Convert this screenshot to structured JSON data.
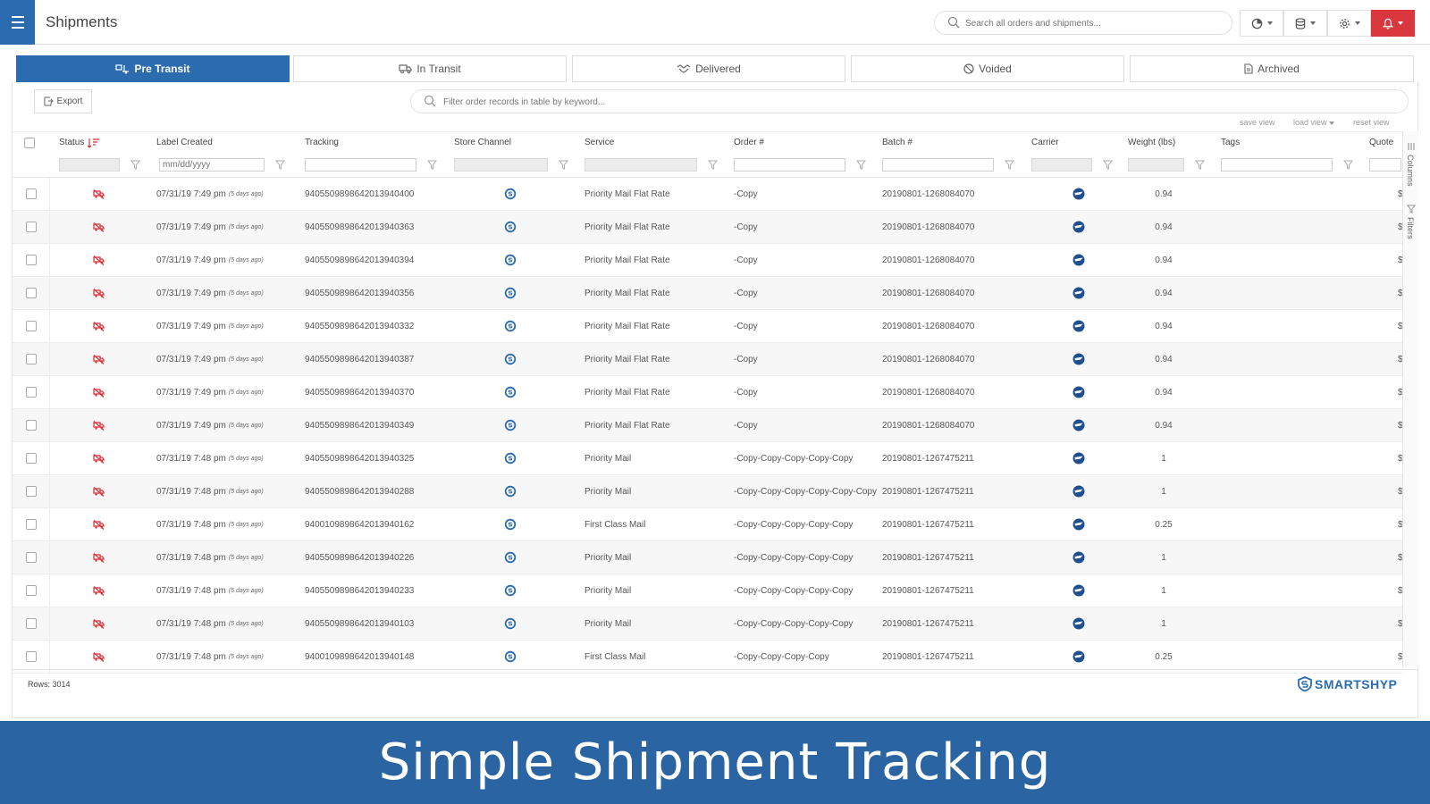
{
  "app": {
    "title": "Shipments"
  },
  "search": {
    "placeholder": "Search all orders and shipments..."
  },
  "toolbar": {
    "buttons": [
      "reports-menu-button",
      "database-menu-button",
      "settings-menu-button",
      "notifications-button"
    ]
  },
  "tabs": [
    {
      "label": "Pre Transit",
      "icon": "truck-loading-icon",
      "active": true
    },
    {
      "label": "In Transit",
      "icon": "truck-icon",
      "active": false
    },
    {
      "label": "Delivered",
      "icon": "handshake-icon",
      "active": false
    },
    {
      "label": "Voided",
      "icon": "ban-icon",
      "active": false
    },
    {
      "label": "Archived",
      "icon": "file-icon",
      "active": false
    }
  ],
  "panel": {
    "export_label": "Export",
    "filter_placeholder": "Filter order records in table by keyword...",
    "save_view": "save view",
    "load_view": "load view",
    "reset_view": "reset view",
    "columns_label": "Columns",
    "filters_label": "Filters",
    "rows_label": "Rows: 3014",
    "brand": "SMARTSHYP"
  },
  "columns": {
    "status": "Status",
    "label_created": "Label Created",
    "tracking": "Tracking",
    "store_channel": "Store Channel",
    "service": "Service",
    "order": "Order #",
    "batch": "Batch #",
    "carrier": "Carrier",
    "weight": "Weight (lbs)",
    "tags": "Tags",
    "quote": "Quote"
  },
  "filters": {
    "date_placeholder": "mm/dd/yyyy"
  },
  "rows": [
    {
      "created": "07/31/19 7:49 pm",
      "ago": "(5 days ago)",
      "tracking": "9405509898642013940400",
      "service": "Priority Mail Flat Rate",
      "order": "-Copy",
      "batch": "20190801-1268084070",
      "weight": "0.94",
      "quote": "$"
    },
    {
      "created": "07/31/19 7:49 pm",
      "ago": "(5 days ago)",
      "tracking": "9405509898642013940363",
      "service": "Priority Mail Flat Rate",
      "order": "-Copy",
      "batch": "20190801-1268084070",
      "weight": "0.94",
      "quote": "$"
    },
    {
      "created": "07/31/19 7:49 pm",
      "ago": "(5 days ago)",
      "tracking": "9405509898642013940394",
      "service": "Priority Mail Flat Rate",
      "order": "-Copy",
      "batch": "20190801-1268084070",
      "weight": "0.94",
      "quote": "$"
    },
    {
      "created": "07/31/19 7:49 pm",
      "ago": "(5 days ago)",
      "tracking": "9405509898642013940356",
      "service": "Priority Mail Flat Rate",
      "order": "-Copy",
      "batch": "20190801-1268084070",
      "weight": "0.94",
      "quote": "$"
    },
    {
      "created": "07/31/19 7:49 pm",
      "ago": "(5 days ago)",
      "tracking": "9405509898642013940332",
      "service": "Priority Mail Flat Rate",
      "order": "-Copy",
      "batch": "20190801-1268084070",
      "weight": "0.94",
      "quote": "$"
    },
    {
      "created": "07/31/19 7:49 pm",
      "ago": "(5 days ago)",
      "tracking": "9405509898642013940387",
      "service": "Priority Mail Flat Rate",
      "order": "-Copy",
      "batch": "20190801-1268084070",
      "weight": "0.94",
      "quote": "$"
    },
    {
      "created": "07/31/19 7:49 pm",
      "ago": "(5 days ago)",
      "tracking": "9405509898642013940370",
      "service": "Priority Mail Flat Rate",
      "order": "-Copy",
      "batch": "20190801-1268084070",
      "weight": "0.94",
      "quote": "$"
    },
    {
      "created": "07/31/19 7:49 pm",
      "ago": "(5 days ago)",
      "tracking": "9405509898642013940349",
      "service": "Priority Mail Flat Rate",
      "order": "-Copy",
      "batch": "20190801-1268084070",
      "weight": "0.94",
      "quote": "$"
    },
    {
      "created": "07/31/19 7:48 pm",
      "ago": "(5 days ago)",
      "tracking": "9405509898642013940325",
      "service": "Priority Mail",
      "order": "-Copy-Copy-Copy-Copy-Copy",
      "batch": "20190801-1267475211",
      "weight": "1",
      "quote": "$"
    },
    {
      "created": "07/31/19 7:48 pm",
      "ago": "(5 days ago)",
      "tracking": "9405509898642013940288",
      "service": "Priority Mail",
      "order": "-Copy-Copy-Copy-Copy-Copy-Copy",
      "batch": "20190801-1267475211",
      "weight": "1",
      "quote": "$"
    },
    {
      "created": "07/31/19 7:48 pm",
      "ago": "(5 days ago)",
      "tracking": "9400109898642013940162",
      "service": "First Class Mail",
      "order": "-Copy-Copy-Copy-Copy-Copy",
      "batch": "20190801-1267475211",
      "weight": "0.25",
      "quote": "$"
    },
    {
      "created": "07/31/19 7:48 pm",
      "ago": "(5 days ago)",
      "tracking": "9405509898642013940226",
      "service": "Priority Mail",
      "order": "-Copy-Copy-Copy-Copy-Copy",
      "batch": "20190801-1267475211",
      "weight": "1",
      "quote": "$"
    },
    {
      "created": "07/31/19 7:48 pm",
      "ago": "(5 days ago)",
      "tracking": "9405509898642013940233",
      "service": "Priority Mail",
      "order": "-Copy-Copy-Copy-Copy-Copy",
      "batch": "20190801-1267475211",
      "weight": "1",
      "quote": "$"
    },
    {
      "created": "07/31/19 7:48 pm",
      "ago": "(5 days ago)",
      "tracking": "9405509898642013940103",
      "service": "Priority Mail",
      "order": "-Copy-Copy-Copy-Copy-Copy",
      "batch": "20190801-1267475211",
      "weight": "1",
      "quote": "$"
    },
    {
      "created": "07/31/19 7:48 pm",
      "ago": "(5 days ago)",
      "tracking": "9400109898642013940148",
      "service": "First Class Mail",
      "order": "-Copy-Copy-Copy-Copy",
      "batch": "20190801-1267475211",
      "weight": "0.25",
      "quote": "$"
    }
  ],
  "banner": {
    "text": "Simple Shipment Tracking"
  },
  "colors": {
    "accent": "#2b6cb0",
    "alert": "#d9363e",
    "status_icon": "#d9363e",
    "banner": "#2a64a2"
  }
}
